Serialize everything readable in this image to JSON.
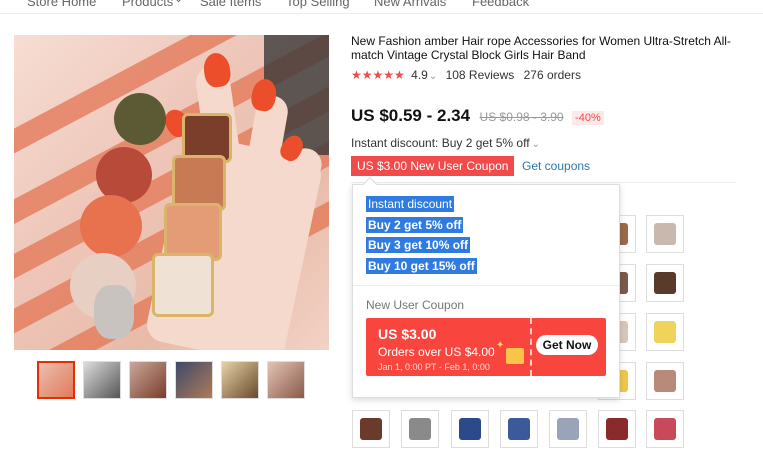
{
  "nav": {
    "items": [
      "Store Home",
      "Products",
      "Sale Items",
      "Top Selling",
      "New Arrivals",
      "Feedback"
    ]
  },
  "product": {
    "title": "New Fashion amber Hair rope Accessories for Women Ultra-Stretch All-match Vintage Crystal Block Girls Hair Band",
    "rating": "4.9",
    "rating_caret": "⌄",
    "reviews": "108 Reviews",
    "orders": "276 orders",
    "price": "US $0.59 - 2.34",
    "old_price": "US $0.98 - 3.90",
    "discount_pct": "-40%",
    "instant_discount": "Instant discount: Buy 2 get 5% off",
    "instant_caret": "⌄",
    "coupon_tag": "US $3.00 New User Coupon",
    "get_coupons": "Get coupons"
  },
  "popup": {
    "heading": "Instant discount",
    "tiers": [
      "Buy 2 get 5% off",
      "Buy 3 get 10% off",
      "Buy 10 get 15% off"
    ],
    "nuc_title": "New User Coupon",
    "coupon": {
      "amount": "US $3.00",
      "condition": "Orders over US $4.00",
      "dates": "Jan 1, 0:00 PT - Feb 1, 0:00",
      "button": "Get Now"
    }
  },
  "colors": {
    "accent": "#f04a4a",
    "link": "#2e7aa8",
    "selection": "#2f7be0",
    "coupon_bg": "#f8463f"
  }
}
